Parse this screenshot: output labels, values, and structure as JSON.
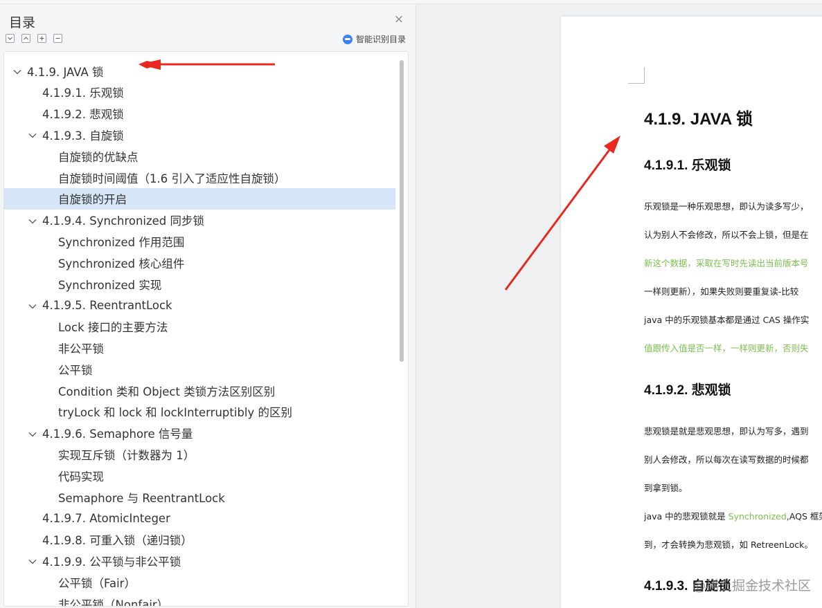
{
  "toc_panel": {
    "title": "目录",
    "smart_toc_label": "智能识别目录",
    "toolbar_icons": [
      "collapse-all-icon",
      "expand-level-icon",
      "expand-plus-icon",
      "collapse-minus-icon"
    ],
    "items": [
      {
        "label": "4.1.9. JAVA  锁",
        "level": 0,
        "expanded": true
      },
      {
        "label": "4.1.9.1.  乐观锁",
        "level": 1
      },
      {
        "label": "4.1.9.2.  悲观锁",
        "level": 1
      },
      {
        "label": "4.1.9.3.  自旋锁",
        "level": 1,
        "expanded": true
      },
      {
        "label": "自旋锁的优缺点",
        "level": 2
      },
      {
        "label": "自旋锁时间阈值（1.6  引入了适应性自旋锁）",
        "level": 2
      },
      {
        "label": "自旋锁的开启",
        "level": 2,
        "selected": true
      },
      {
        "label": "4.1.9.4. Synchronized  同步锁",
        "level": 1,
        "expanded": true
      },
      {
        "label": "Synchronized  作用范围",
        "level": 2
      },
      {
        "label": "Synchronized  核心组件",
        "level": 2
      },
      {
        "label": "Synchronized  实现",
        "level": 2
      },
      {
        "label": "4.1.9.5. ReentrantLock",
        "level": 1,
        "expanded": true
      },
      {
        "label": "Lock  接口的主要方法",
        "level": 2
      },
      {
        "label": "非公平锁",
        "level": 2
      },
      {
        "label": "公平锁",
        "level": 2
      },
      {
        "label": "Condition  类和  Object  类锁方法区别区别",
        "level": 2
      },
      {
        "label": "tryLock  和  lock  和  lockInterruptibly  的区别",
        "level": 2
      },
      {
        "label": "4.1.9.6. Semaphore  信号量",
        "level": 1,
        "expanded": true
      },
      {
        "label": "实现互斥锁（计数器为  1）",
        "level": 2
      },
      {
        "label": "代码实现",
        "level": 2
      },
      {
        "label": "Semaphore  与  ReentrantLock",
        "level": 2
      },
      {
        "label": "4.1.9.7. AtomicInteger",
        "level": 1
      },
      {
        "label": "4.1.9.8.  可重入锁（递归锁）",
        "level": 1
      },
      {
        "label": "4.1.9.9.  公平锁与非公平锁",
        "level": 1,
        "expanded": true
      },
      {
        "label": "公平锁（Fair）",
        "level": 2
      },
      {
        "label": "非公平锁（Nonfair）",
        "level": 2
      }
    ]
  },
  "document": {
    "h1": "4.1.9. JAVA  锁",
    "sections": [
      {
        "heading": "4.1.9.1.  乐观锁",
        "lines": [
          {
            "text": "乐观锁是一种乐观思想，即认为读多写少，",
            "green": false
          },
          {
            "text": "认为别人不会修改，所以不会上锁，但是在",
            "green": false
          },
          {
            "text": "新这个数据，采取在写时先读出当前版本号",
            "green": true
          },
          {
            "text": "一样则更新），如果失败则要重复读-比较",
            "green": false
          },
          {
            "text": "java  中的乐观锁基本都是通过  CAS  操作实",
            "green": false
          },
          {
            "text": "值跟传入值是否一样，一样则更新，否则失",
            "green": true
          }
        ]
      },
      {
        "heading": "4.1.9.2.  悲观锁",
        "lines": [
          {
            "text": "悲观锁是就是悲观思想，即认为写多，遇到",
            "green": false
          },
          {
            "text": "别人会修改，所以每次在读写数据的时候都",
            "green": false
          },
          {
            "text": "到拿到锁。",
            "green": false
          },
          {
            "text_pre": "java 中的悲观锁就是 ",
            "text_green": "Synchronized",
            "text_post": ",AQS 框架",
            "mixed": true
          },
          {
            "text": "到，才会转换为悲观锁，如  RetreenLock。",
            "green": false
          }
        ]
      },
      {
        "heading": "4.1.9.3.  自旋锁",
        "lines": []
      }
    ]
  },
  "watermark": "@稀土掘金技术社区",
  "colors": {
    "accent_selected": "#d7e5f8",
    "green_text": "#7cbf4e",
    "arrow_red": "#e8281e"
  }
}
